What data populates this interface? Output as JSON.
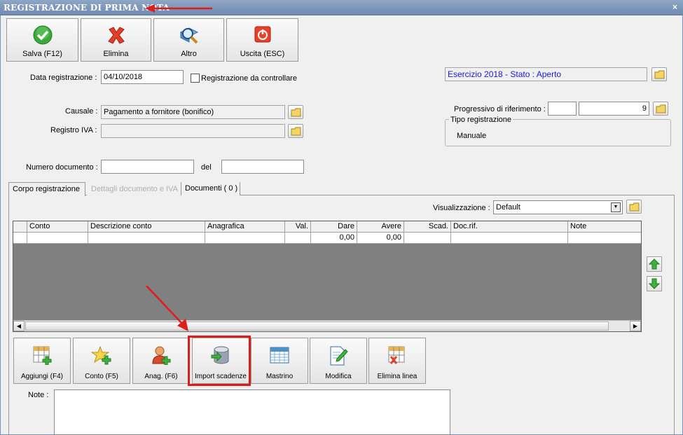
{
  "window": {
    "title": "REGISTRAZIONE DI PRIMA NOTA",
    "close": "×"
  },
  "toolbar": {
    "save": "Salva (F12)",
    "delete": "Elimina",
    "other": "Altro",
    "exit": "Uscita (ESC)"
  },
  "form": {
    "data_label": "Data registrazione :",
    "data_value": "04/10/2018",
    "check_label": "Registrazione da controllare",
    "esercizio": "Esercizio 2018 - Stato : Aperto",
    "causale_label": "Causale :",
    "causale_value": "Pagamento a fornitore (bonifico)",
    "registro_label": "Registro IVA :",
    "registro_value": "",
    "progressivo_label": "Progressivo di riferimento :",
    "progressivo_value1": "",
    "progressivo_value2": "9",
    "tipo_label": "Tipo registrazione",
    "tipo_value": "Manuale",
    "numdoc_label": "Numero documento :",
    "numdoc_value": "",
    "del_label": "del",
    "del_value": ""
  },
  "tabs": [
    {
      "label": "Corpo registrazione",
      "active": true
    },
    {
      "label": "Dettagli documento e IVA",
      "disabled": true
    },
    {
      "label": "Documenti ( 0 )"
    }
  ],
  "view": {
    "label": "Visualizzazione :",
    "value": "Default"
  },
  "grid": {
    "columns": [
      "Conto",
      "Descrizione conto",
      "Anagrafica",
      "Val.",
      "Dare",
      "Avere",
      "Scad.",
      "Doc.rif.",
      "Note"
    ],
    "row": [
      "",
      "",
      "",
      "",
      "0,00",
      "0,00",
      "",
      "",
      ""
    ]
  },
  "actions": {
    "add": "Aggiungi (F4)",
    "conto": "Conto (F5)",
    "anag": "Anag. (F6)",
    "import": "Import scadenze",
    "mastrino": "Mastrino",
    "modifica": "Modifica",
    "elimina": "Elimina linea"
  },
  "note_label": "Note :",
  "colors": {
    "annotation": "#e01b1b",
    "title_bar": "#7f97bb",
    "esercizio_text": "#1a1ad6"
  }
}
